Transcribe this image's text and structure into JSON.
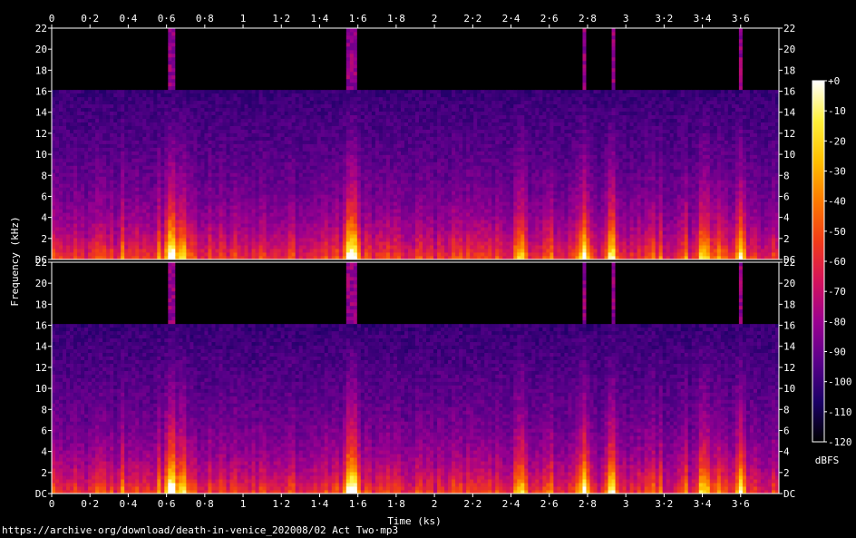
{
  "source_url": "https://archive·org/download/death-in-venice_202008/02 Act Two·mp3",
  "chart_data": {
    "type": "heatmap",
    "title": "",
    "xlabel": "Time (ks)",
    "ylabel": "Frequency (kHz)",
    "xlim": [
      0,
      3.8
    ],
    "x_ticks": [
      "0",
      "0·2",
      "0·4",
      "0·6",
      "0·8",
      "1",
      "1·2",
      "1·4",
      "1·6",
      "1·8",
      "2",
      "2·2",
      "2·4",
      "2·6",
      "2·8",
      "3",
      "3·2",
      "3·4",
      "3·6"
    ],
    "x_tick_values": [
      0,
      0.2,
      0.4,
      0.6,
      0.8,
      1.0,
      1.2,
      1.4,
      1.6,
      1.8,
      2.0,
      2.2,
      2.4,
      2.6,
      2.8,
      3.0,
      3.2,
      3.4,
      3.6
    ],
    "channels": 2,
    "ylim": [
      0,
      22
    ],
    "y_ticks": [
      "DC",
      "2",
      "4",
      "6",
      "8",
      "10",
      "12",
      "14",
      "16",
      "18",
      "20",
      "22"
    ],
    "y_tick_values": [
      0,
      2,
      4,
      6,
      8,
      10,
      12,
      14,
      16,
      18,
      20,
      22
    ],
    "bandwidth_cutoff_khz": 16,
    "colorbar": {
      "label": "dBFS",
      "ticks": [
        "+0",
        "-10",
        "-20",
        "-30",
        "-40",
        "-50",
        "-60",
        "-70",
        "-80",
        "-90",
        "-100",
        "-110",
        "-120"
      ],
      "tick_values": [
        0,
        -10,
        -20,
        -30,
        -40,
        -50,
        -60,
        -70,
        -80,
        -90,
        -100,
        -110,
        -120
      ],
      "range": [
        -120,
        0
      ],
      "colors": [
        "#000000",
        "#1b0066",
        "#5a008a",
        "#9a0090",
        "#d3125c",
        "#f23c18",
        "#fc7a00",
        "#ffbf00",
        "#fff03a",
        "#ffffff"
      ]
    },
    "loud_events_ks": [
      0.62,
      0.68,
      1.55,
      1.58,
      2.45,
      2.78,
      2.93,
      3.42,
      3.6
    ]
  }
}
